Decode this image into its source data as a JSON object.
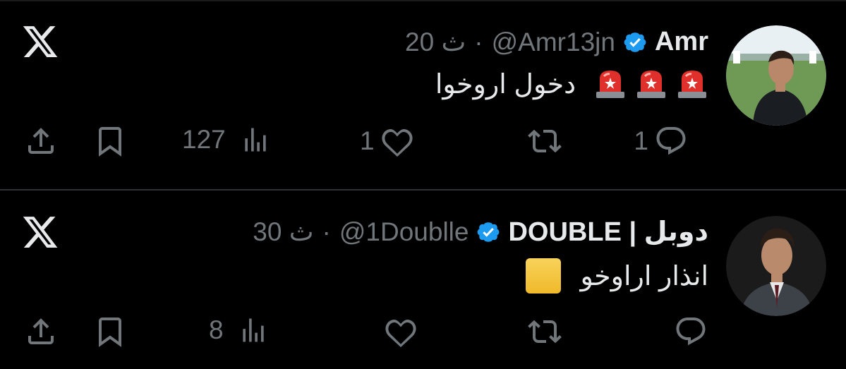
{
  "tweets": [
    {
      "name": "Amr",
      "handle": "@Amr13jn",
      "separator": "·",
      "time": "20 ث",
      "text": "دخول اروخوا",
      "emoji": [
        "police-car-light",
        "police-car-light",
        "police-car-light"
      ],
      "counts": {
        "replies": "1",
        "retweets": "",
        "likes": "1",
        "views": "127"
      }
    },
    {
      "name": "دوبل | DOUBLE",
      "handle": "@1Doublle",
      "separator": "·",
      "time": "30 ث",
      "text": "انذار اراوخو",
      "emoji": [
        "yellow-square"
      ],
      "counts": {
        "replies": "",
        "retweets": "",
        "likes": "",
        "views": "8"
      }
    }
  ],
  "colors": {
    "background": "#000000",
    "text": "#e7e9ea",
    "muted": "#71767b",
    "verified": "#1d9bf0",
    "divider": "#2f3336"
  }
}
